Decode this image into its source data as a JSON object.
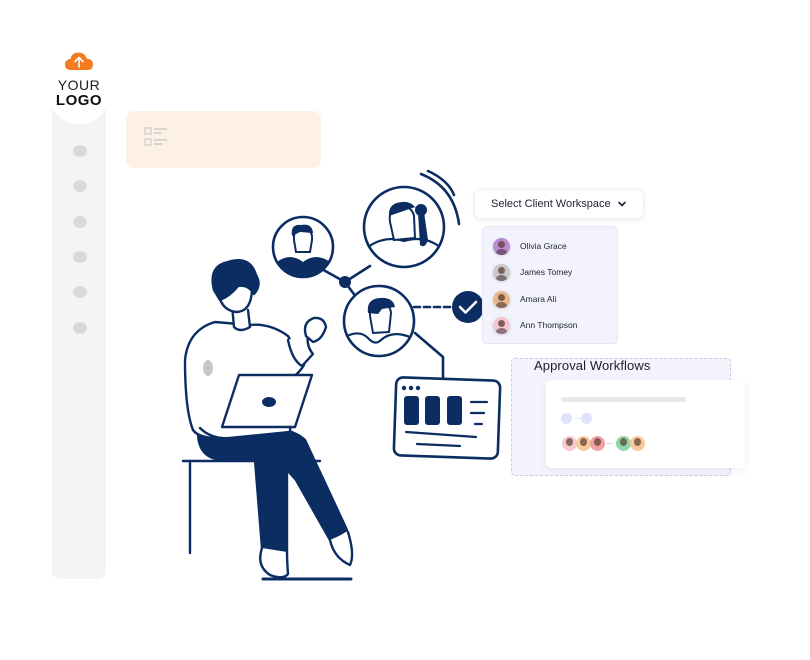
{
  "logo": {
    "icon": "cloud-upload-icon",
    "line1": "YOUR",
    "line2": "LOGO",
    "accent_color": "#f47b20"
  },
  "sidebar": {
    "items": [
      {
        "icon": "nav-dot"
      },
      {
        "icon": "nav-dot"
      },
      {
        "icon": "nav-dot"
      },
      {
        "icon": "nav-dot"
      },
      {
        "icon": "nav-dot"
      },
      {
        "icon": "nav-dot"
      }
    ]
  },
  "top_card": {
    "icon": "list-icon",
    "background": "#fdf1e5"
  },
  "workspace_selector": {
    "label": "Select Client Workspace",
    "icon": "chevron-down-icon",
    "clients": [
      {
        "name": "Olivia  Grace",
        "avatar_color": "#b98ad0"
      },
      {
        "name": "James Tomey",
        "avatar_color": "#c9c9c9"
      },
      {
        "name": "Amara  Ali",
        "avatar_color": "#e9b88a"
      },
      {
        "name": "Ann Thompson",
        "avatar_color": "#f3c6d0"
      }
    ]
  },
  "approval_workflows": {
    "title": "Approval Workflows",
    "steps": 2,
    "approvers_group_1": [
      {
        "avatar_color": "#f6c9d3"
      },
      {
        "avatar_color": "#f8c99a"
      },
      {
        "avatar_color": "#f0a1a6"
      }
    ],
    "approvers_group_2": [
      {
        "avatar_color": "#8fd7a8"
      },
      {
        "avatar_color": "#f8c99a"
      }
    ]
  },
  "illustration": {
    "primary_color": "#0b2d62",
    "description": "Person with laptop connected to team network"
  }
}
